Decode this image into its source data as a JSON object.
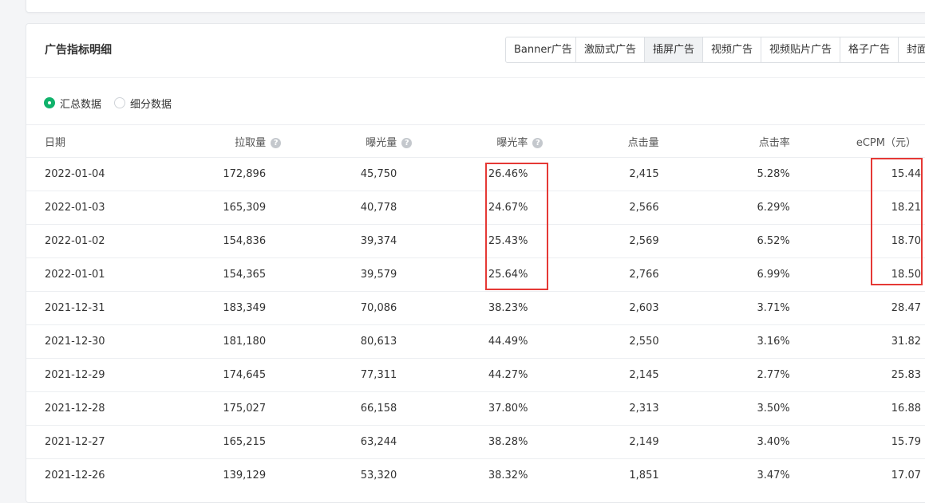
{
  "card": {
    "title": "广告指标明细"
  },
  "tabs": [
    {
      "label": "Banner广告",
      "active": false
    },
    {
      "label": "激励式广告",
      "active": false
    },
    {
      "label": "插屏广告",
      "active": true
    },
    {
      "label": "视频广告",
      "active": false
    },
    {
      "label": "视频贴片广告",
      "active": false
    },
    {
      "label": "格子广告",
      "active": false
    },
    {
      "label": "封面",
      "active": false
    }
  ],
  "radios": [
    {
      "label": "汇总数据",
      "checked": true
    },
    {
      "label": "细分数据",
      "checked": false
    }
  ],
  "table": {
    "headers": {
      "date": "日期",
      "pulls": "拉取量",
      "impressions": "曝光量",
      "impression_rate": "曝光率",
      "clicks": "点击量",
      "ctr": "点击率",
      "ecpm": "eCPM（元）"
    },
    "rows": [
      [
        "2022-01-04",
        "172,896",
        "45,750",
        "26.46%",
        "2,415",
        "5.28%",
        "15.44"
      ],
      [
        "2022-01-03",
        "165,309",
        "40,778",
        "24.67%",
        "2,566",
        "6.29%",
        "18.21"
      ],
      [
        "2022-01-02",
        "154,836",
        "39,374",
        "25.43%",
        "2,569",
        "6.52%",
        "18.70"
      ],
      [
        "2022-01-01",
        "154,365",
        "39,579",
        "25.64%",
        "2,766",
        "6.99%",
        "18.50"
      ],
      [
        "2021-12-31",
        "183,349",
        "70,086",
        "38.23%",
        "2,603",
        "3.71%",
        "28.47"
      ],
      [
        "2021-12-30",
        "181,180",
        "80,613",
        "44.49%",
        "2,550",
        "3.16%",
        "31.82"
      ],
      [
        "2021-12-29",
        "174,645",
        "77,311",
        "44.27%",
        "2,145",
        "2.77%",
        "25.83"
      ],
      [
        "2021-12-28",
        "175,027",
        "66,158",
        "37.80%",
        "2,313",
        "3.50%",
        "16.88"
      ],
      [
        "2021-12-27",
        "165,215",
        "63,244",
        "38.28%",
        "2,149",
        "3.40%",
        "15.79"
      ],
      [
        "2021-12-26",
        "139,129",
        "53,320",
        "38.32%",
        "1,851",
        "3.47%",
        "17.07"
      ]
    ]
  },
  "help_icon": "question-circle-icon",
  "highlight_color": "#e53935",
  "accent_color": "#10b26b"
}
